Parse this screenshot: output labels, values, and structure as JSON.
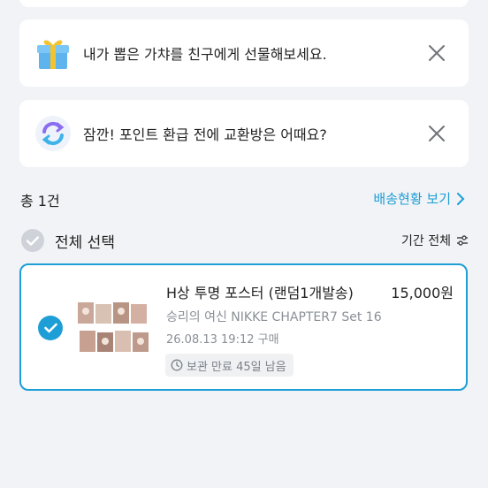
{
  "banners": [
    {
      "text": "내가 뽑은 가챠를 친구에게 선물해보세요.",
      "icon": "gift-box-icon"
    },
    {
      "text": "잠깐! 포인트 환급 전에 교환방은 어때요?",
      "icon": "exchange-refresh-icon"
    }
  ],
  "summary": {
    "count": "총 1건",
    "delivery_link": "배송현황 보기"
  },
  "filter": {
    "select_all": "전체 선택",
    "period": "기간 전체"
  },
  "item": {
    "title": "H상 투명 포스터 (랜덤1개발송)",
    "price": "15,000원",
    "subtitle": "승리의 여신 NIKKE CHAPTER7 Set 16",
    "date": "26.08.13 19:12 구매",
    "storage": "보관 만료 45일 남음",
    "selected": true
  },
  "colors": {
    "accent": "#1e9ed6",
    "background": "#f1f3f6"
  }
}
